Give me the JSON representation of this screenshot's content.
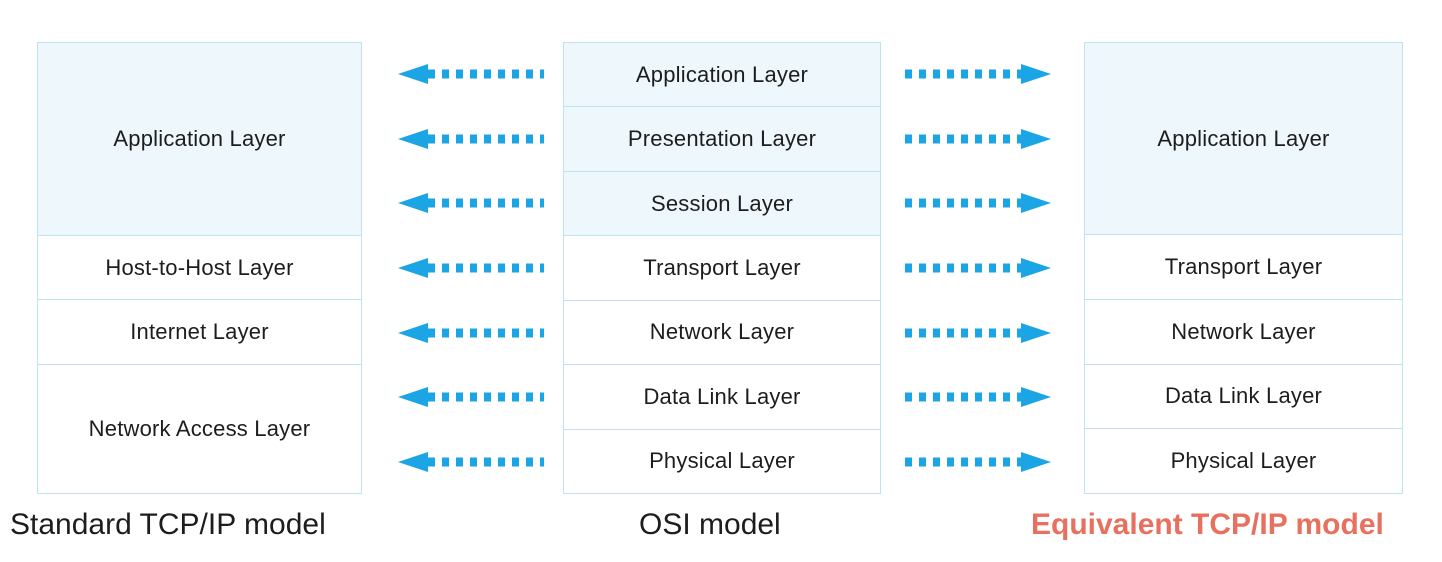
{
  "diagram": {
    "title_left": "Standard TCP/IP model",
    "title_middle": "OSI model",
    "title_right": "Equivalent TCP/IP model",
    "colors": {
      "box_border": "#bfe3f2",
      "box_tint_fill": "#eef8fc",
      "box_plain_fill": "#ffffff",
      "arrow": "#1ba5e4",
      "text": "#1d1d1d",
      "accent_caption": "#e8705f"
    },
    "columns": {
      "tcpip": {
        "name": "Standard TCP/IP model",
        "cells": [
          {
            "label": "Application Layer",
            "span": 3,
            "tint": true
          },
          {
            "label": "Host-to-Host Layer",
            "span": 1,
            "tint": false
          },
          {
            "label": "Internet Layer",
            "span": 1,
            "tint": false
          },
          {
            "label": "Network Access Layer",
            "span": 2,
            "tint": false
          }
        ]
      },
      "osi": {
        "name": "OSI model",
        "cells": [
          {
            "label": "Application Layer",
            "span": 1,
            "tint": true
          },
          {
            "label": "Presentation Layer",
            "span": 1,
            "tint": true
          },
          {
            "label": "Session Layer",
            "span": 1,
            "tint": true
          },
          {
            "label": "Transport Layer",
            "span": 1,
            "tint": false
          },
          {
            "label": "Network Layer",
            "span": 1,
            "tint": false
          },
          {
            "label": "Data Link Layer",
            "span": 1,
            "tint": false
          },
          {
            "label": "Physical Layer",
            "span": 1,
            "tint": false
          }
        ]
      },
      "equivalent": {
        "name": "Equivalent TCP/IP model",
        "cells": [
          {
            "label": "Application Layer",
            "span": 3,
            "tint": true
          },
          {
            "label": "Transport Layer",
            "span": 1,
            "tint": false
          },
          {
            "label": "Network Layer",
            "span": 1,
            "tint": false
          },
          {
            "label": "Data Link Layer",
            "span": 1,
            "tint": false
          },
          {
            "label": "Physical Layer",
            "span": 1,
            "tint": false
          }
        ]
      }
    },
    "arrows": {
      "left_lane": {
        "direction": "left",
        "style": "dotted",
        "count": 7,
        "from_layers": [
          "Application Layer",
          "Presentation Layer",
          "Session Layer",
          "Transport Layer",
          "Network Layer",
          "Data Link Layer",
          "Physical Layer"
        ],
        "to_column": "Standard TCP/IP model"
      },
      "right_lane": {
        "direction": "right",
        "style": "dotted",
        "count": 7,
        "from_layers": [
          "Application Layer",
          "Presentation Layer",
          "Session Layer",
          "Transport Layer",
          "Network Layer",
          "Data Link Layer",
          "Physical Layer"
        ],
        "to_column": "Equivalent TCP/IP model"
      }
    }
  }
}
